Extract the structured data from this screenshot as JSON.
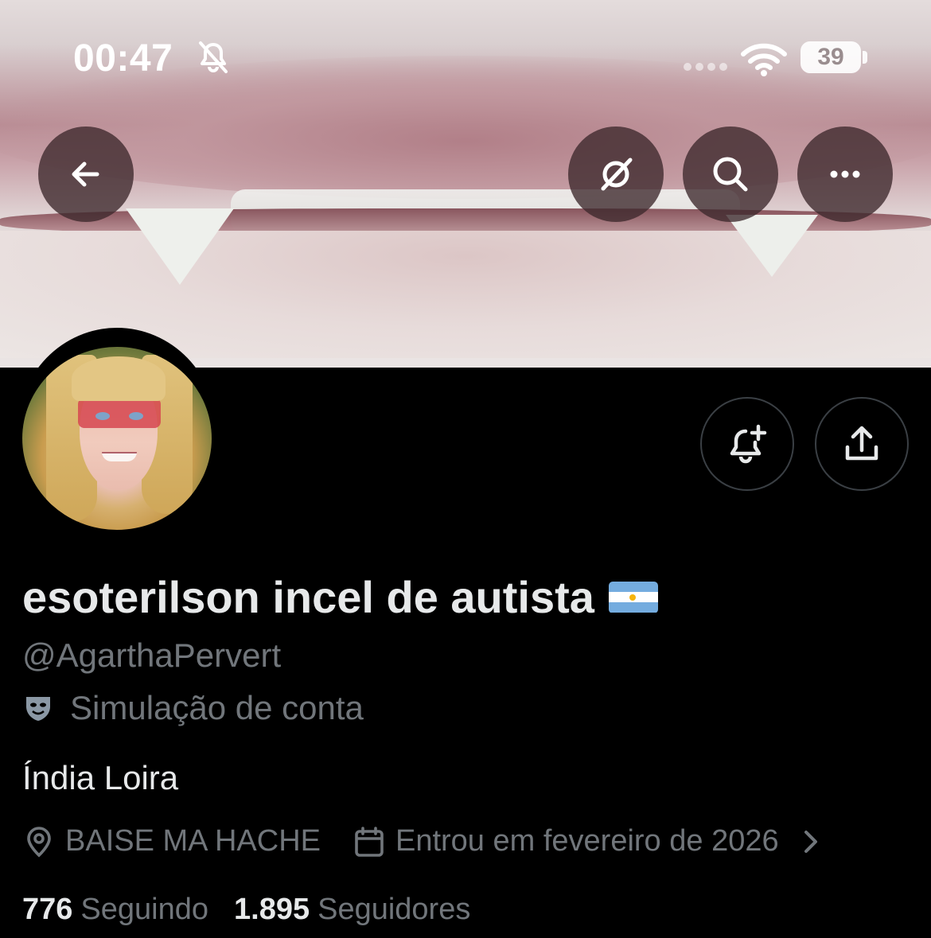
{
  "status_bar": {
    "time": "00:47",
    "battery": "39"
  },
  "profile": {
    "display_name": "esoterilson incel de autista",
    "handle": "@AgarthaPervert",
    "parody_label": "Simulação de conta",
    "bio": "Índia Loira",
    "location": "BAISE MA HACHE",
    "joined": "Entrou em fevereiro de 2026",
    "following_count": "776",
    "following_label": "Seguindo",
    "followers_count": "1.895",
    "followers_label": "Seguidores"
  },
  "icons": {
    "back": "arrow-left-icon",
    "grok": "grok-icon",
    "search": "search-icon",
    "more": "more-icon",
    "notify": "bell-plus-icon",
    "share": "share-icon",
    "parody": "mask-icon",
    "location": "location-pin-icon",
    "calendar": "calendar-icon"
  },
  "colors": {
    "background": "#000000",
    "primary_text": "#e7e9ea",
    "secondary_text": "#71767b",
    "flag_blue": "#74acdf"
  }
}
